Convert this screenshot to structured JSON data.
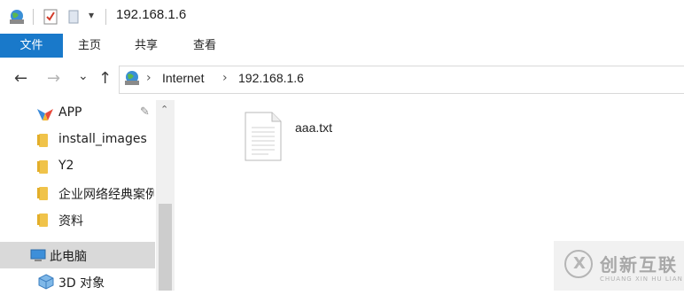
{
  "window": {
    "title": "192.168.1.6"
  },
  "quick_access": {
    "dropdown_glyph": "▾"
  },
  "ribbon": {
    "tabs": [
      {
        "label": "文件"
      },
      {
        "label": "主页"
      },
      {
        "label": "共享"
      },
      {
        "label": "查看"
      }
    ],
    "accent": "#1979ca"
  },
  "nav": {
    "back_glyph": "←",
    "forward_glyph": "→",
    "recent_glyph": "⌄",
    "up_glyph": "↑"
  },
  "address": {
    "crumbs": [
      {
        "label": "Internet"
      },
      {
        "label": "192.168.1.6"
      }
    ],
    "sep": "›"
  },
  "sidebar": {
    "items": [
      {
        "label": "APP",
        "icon": "app-icon",
        "pinned": true
      },
      {
        "label": "install_images",
        "icon": "folder-icon"
      },
      {
        "label": "Y2",
        "icon": "folder-icon"
      },
      {
        "label": "企业网络经典案例",
        "icon": "folder-icon"
      },
      {
        "label": "资料",
        "icon": "folder-icon"
      },
      {
        "label": "此电脑",
        "icon": "computer-icon",
        "selected": true
      },
      {
        "label": "3D 对象",
        "icon": "3d-objects-icon"
      }
    ],
    "pin_glyph": "✎",
    "scroll_up_glyph": "⌃"
  },
  "content": {
    "files": [
      {
        "name": "aaa.txt",
        "icon": "text-file-icon"
      }
    ]
  },
  "watermark": {
    "text": "创新互联",
    "subtext": "CHUANG XIN HU LIAN"
  }
}
